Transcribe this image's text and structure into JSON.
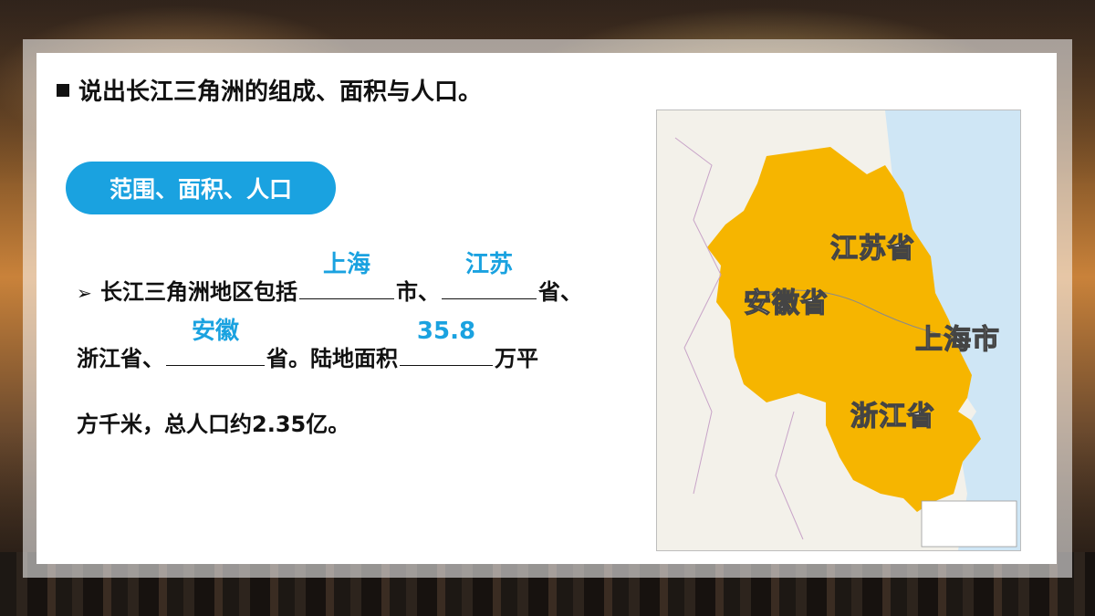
{
  "slide": {
    "title": "说出长江三角洲的组成、面积与人口。",
    "section_pill": "范围、面积、人口",
    "bullet_symbol": "➢",
    "paragraph": {
      "part1": "长江三角洲地区包括",
      "blank1_answer": "上海",
      "part2": "市、",
      "blank2_answer": "江苏",
      "part3": "省、",
      "part4": "浙江省、",
      "blank3_answer": "安徽",
      "part5": "省。陆地面积",
      "blank4_answer": "35.8",
      "part6": "万平",
      "part7": "方千米，总人口约2.35亿。"
    }
  },
  "map": {
    "labels": {
      "jiangsu": "江苏省",
      "anhui": "安徽省",
      "shanghai": "上海市",
      "zhejiang": "浙江省"
    },
    "colors": {
      "region": "#f6b500",
      "sea": "#cfe6f5",
      "land": "#f3f1ea"
    }
  },
  "colors": {
    "accent": "#1aa2e0",
    "text": "#111111"
  }
}
